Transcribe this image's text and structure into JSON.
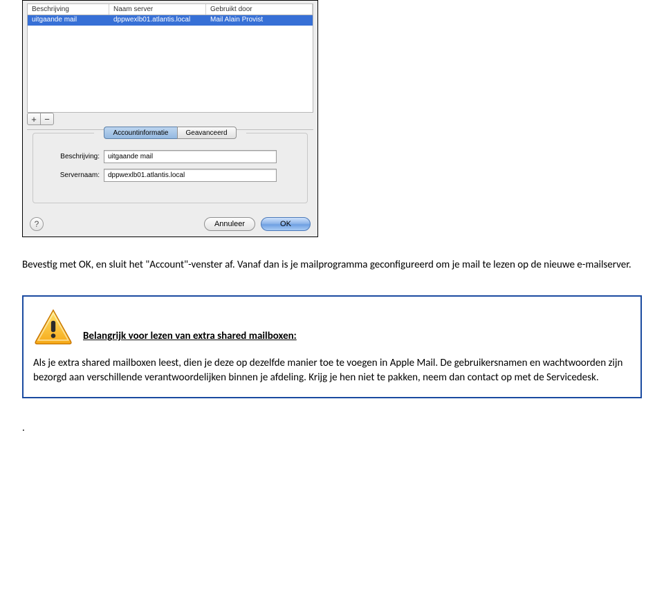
{
  "dialog": {
    "table": {
      "headers": {
        "desc": "Beschrijving",
        "server": "Naam server",
        "used": "Gebruikt door"
      },
      "row": {
        "desc": "uitgaande mail",
        "server": "dppwexlb01.atlantis.local",
        "used": "Mail Alain Provist"
      }
    },
    "buttons": {
      "add": "+",
      "remove": "−"
    },
    "tabs": {
      "info": "Accountinformatie",
      "advanced": "Geavanceerd"
    },
    "form": {
      "desc_label": "Beschrijving:",
      "desc_value": "uitgaande mail",
      "server_label": "Servernaam:",
      "server_value": "dppwexlb01.atlantis.local"
    },
    "footer": {
      "help": "?",
      "cancel": "Annuleer",
      "ok": "OK"
    }
  },
  "paragraph": "Bevestig met OK, en sluit het \"Account\"-venster af. Vanaf dan is je mailprogramma geconfigureerd om je mail te lezen op de nieuwe e-mailserver.",
  "warning": {
    "title": "Belangrijk voor lezen van extra shared mailboxen:",
    "body": "Als je extra shared mailboxen leest, dien je deze op dezelfde manier toe te voegen in Apple Mail. De gebruikersnamen en wachtwoorden zijn bezorgd aan verschillende verantwoordelijken binnen je afdeling. Krijg je hen niet te pakken, neem dan contact op met de Servicedesk."
  },
  "trailing_dot": "."
}
